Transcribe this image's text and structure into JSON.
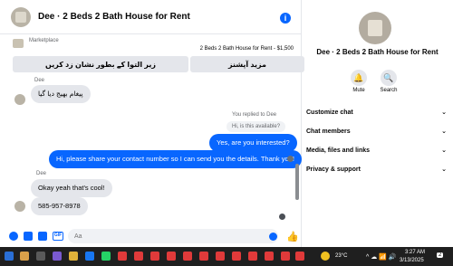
{
  "chat": {
    "title": "Dee · 2 Beds 2 Bath House for Rent",
    "marketplace": {
      "label": "Marketplace",
      "listing": "2 Beds 2 Bath House for Rent - $1,500",
      "btn_left": "زیر التوا کے بطور نشان زد کریں",
      "btn_right": "مزید آپشنز"
    },
    "messages": [
      {
        "sender": "Dee",
        "text": "پیغام بھیج دیا گیا",
        "dir": "in"
      },
      {
        "replied": "You replied to Dee",
        "quoted": "Hi, is this available?"
      },
      {
        "text": "Yes, are you interested?",
        "dir": "out"
      },
      {
        "text": "Hi, please share your contact number so I can send you the details. Thank you!",
        "dir": "out"
      },
      {
        "sender": "Dee",
        "text": "Okay yeah that's cool!",
        "dir": "in"
      },
      {
        "text": "585-957-8978",
        "dir": "in"
      }
    ],
    "composer_placeholder": "Aa"
  },
  "details": {
    "name": "Dee · 2 Beds 2 Bath House for Rent",
    "actions": [
      {
        "label": "Mute",
        "icon": "bell-icon"
      },
      {
        "label": "Search",
        "icon": "search-icon"
      }
    ],
    "sections": [
      "Customize chat",
      "Chat members",
      "Media, files and links",
      "Privacy & support"
    ]
  },
  "taskbar": {
    "temperature": "23°C",
    "time": "3:27 AM",
    "date": "3/13/2025",
    "notification_count": "2"
  },
  "colors": {
    "accent": "#0866ff",
    "bubble_in": "#e4e6eb",
    "taskbar": "#1f1f1f"
  }
}
